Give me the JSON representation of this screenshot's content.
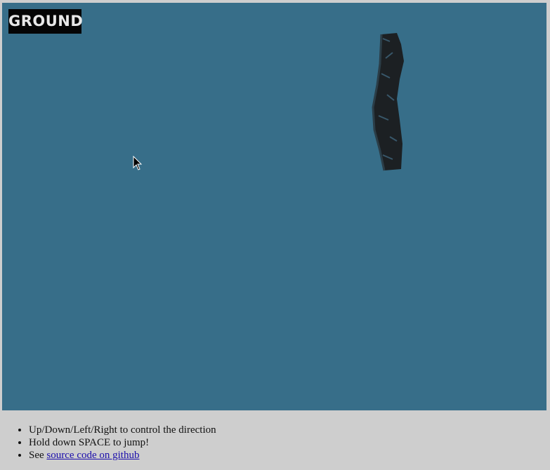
{
  "game": {
    "hud_label": "GROUND",
    "background_color": "#376e89",
    "trail_color": "#1c2023"
  },
  "instructions": {
    "line1": "Up/Down/Left/Right to control the direction",
    "line2": "Hold down SPACE to jump!",
    "line3_prefix": "See",
    "line3_link": "source code on github"
  }
}
